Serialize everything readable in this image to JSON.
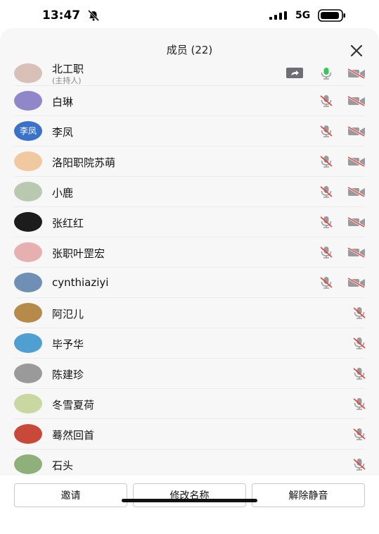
{
  "status_bar": {
    "time": "13:47",
    "network": "5G"
  },
  "header": {
    "title": "成员 (22)"
  },
  "members": [
    {
      "name": "北工职",
      "subtitle": "(主持人)",
      "avatar": "photo",
      "avatar_color": "#d8c0b8",
      "icons": [
        "screen-share",
        "mic-on",
        "camera-off"
      ]
    },
    {
      "name": "白琳",
      "avatar": "photo",
      "avatar_color": "#8f87c9",
      "icons": [
        "mic-off",
        "camera-off"
      ]
    },
    {
      "name": "李凤",
      "avatar": "text",
      "avatar_text": "李凤",
      "avatar_color": "#3a72c9",
      "icons": [
        "mic-off",
        "camera-off"
      ]
    },
    {
      "name": "洛阳职院苏萌",
      "avatar": "photo",
      "avatar_color": "#f0c9a0",
      "icons": [
        "mic-off",
        "camera-off"
      ]
    },
    {
      "name": "小鹿",
      "avatar": "photo",
      "avatar_color": "#b9c9b0",
      "icons": [
        "mic-off",
        "camera-off"
      ]
    },
    {
      "name": "张红红",
      "avatar": "photo",
      "avatar_color": "#1c1c1c",
      "icons": [
        "mic-off",
        "camera-off"
      ]
    },
    {
      "name": "张职叶罡宏",
      "avatar": "photo",
      "avatar_color": "#e7b0b0",
      "icons": [
        "mic-off",
        "camera-off"
      ]
    },
    {
      "name": "cynthiaziyi",
      "avatar": "photo",
      "avatar_color": "#6f8fb5",
      "icons": [
        "mic-off",
        "camera-off"
      ]
    },
    {
      "name": "阿氾儿",
      "avatar": "photo",
      "avatar_color": "#b58a4a",
      "icons": [
        "mic-off"
      ]
    },
    {
      "name": "毕予华",
      "avatar": "photo",
      "avatar_color": "#4fa0d0",
      "icons": [
        "mic-off"
      ]
    },
    {
      "name": "陈建珍",
      "avatar": "photo",
      "avatar_color": "#9a9a9a",
      "icons": [
        "mic-off"
      ]
    },
    {
      "name": "冬雪夏荷",
      "avatar": "photo",
      "avatar_color": "#c8d8a0",
      "icons": [
        "mic-off"
      ]
    },
    {
      "name": "蓦然回首",
      "avatar": "photo",
      "avatar_color": "#c8493a",
      "icons": [
        "mic-off"
      ]
    },
    {
      "name": "石头",
      "avatar": "photo",
      "avatar_color": "#8fb07a",
      "icons": [
        "mic-off"
      ]
    }
  ],
  "actions": {
    "invite": "邀请",
    "rename": "修改名称",
    "unmute": "解除静音"
  },
  "colors": {
    "muted_red": "#e0453a",
    "mic_green": "#34c759",
    "icon_gray": "#9a9a9e"
  }
}
